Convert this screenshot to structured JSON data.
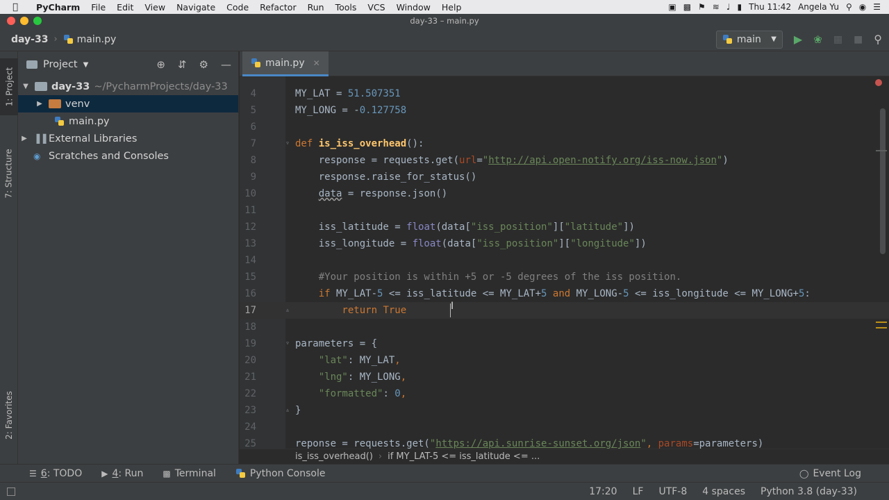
{
  "menubar": {
    "app_name": "PyCharm",
    "items": [
      "File",
      "Edit",
      "View",
      "Navigate",
      "Code",
      "Refactor",
      "Run",
      "Tools",
      "VCS",
      "Window",
      "Help"
    ],
    "clock": "Thu 11:42",
    "user": "Angela Yu"
  },
  "window": {
    "title": "day-33 – main.py"
  },
  "navbar": {
    "project": "day-33",
    "file": "main.py",
    "run_config": "main"
  },
  "left_stripe": {
    "project_tab": "1: Project",
    "structure_tab": "7: Structure",
    "favorites_tab": "2: Favorites"
  },
  "project_panel": {
    "title": "Project",
    "root_name": "day-33",
    "root_path": "~/PycharmProjects/day-33",
    "venv": "venv",
    "main_file": "main.py",
    "external_libraries": "External Libraries",
    "scratches": "Scratches and Consoles"
  },
  "editor": {
    "tab_label": "main.py",
    "current_line": 17,
    "line_numbers": [
      "4",
      "5",
      "6",
      "7",
      "8",
      "9",
      "10",
      "11",
      "12",
      "13",
      "14",
      "15",
      "16",
      "17",
      "18",
      "19",
      "20",
      "21",
      "22",
      "23",
      "24",
      "25"
    ],
    "code": {
      "l4_a": "MY_LAT = ",
      "l4_num": "51.507351",
      "l5_a": "MY_LONG = -",
      "l5_num": "0.127758",
      "l7_def": "def ",
      "l7_fn": "is_iss_overhead",
      "l7_rest": "():",
      "l8_a": "    response = requests.get(",
      "l8_param": "url",
      "l8_eq": "=",
      "l8_q1": "\"",
      "l8_url": "http://api.open-notify.org/iss-now.json",
      "l8_q2": "\"",
      "l8_end": ")",
      "l9": "    response.raise_for_status()",
      "l10_indent": "    ",
      "l10_data": "data",
      "l10_rest": " = response.json()",
      "l12_a": "    iss_latitude = ",
      "l12_fn": "float",
      "l12_b": "(data[",
      "l12_s1": "\"iss_position\"",
      "l12_c": "][",
      "l12_s2": "\"latitude\"",
      "l12_d": "])",
      "l13_a": "    iss_longitude = ",
      "l13_fn": "float",
      "l13_b": "(data[",
      "l13_s1": "\"iss_position\"",
      "l13_c": "][",
      "l13_s2": "\"longitude\"",
      "l13_d": "])",
      "l15": "    #Your position is within +5 or -5 degrees of the iss position.",
      "l16_if": "    if ",
      "l16_a": "MY_LAT-",
      "l16_n1": "5",
      "l16_b": " <= iss_latitude <= MY_LAT+",
      "l16_n2": "5",
      "l16_and": " and ",
      "l16_c": "MY_LONG-",
      "l16_n3": "5",
      "l16_d": " <= iss_longitude <= MY_LONG+",
      "l16_n4": "5",
      "l16_e": ":",
      "l17_ret": "        return ",
      "l17_true": "True",
      "l19": "parameters = {",
      "l20_s": "    \"lat\"",
      "l20_rest": ": MY_LAT",
      "l20_comma": ",",
      "l21_s": "    \"lng\"",
      "l21_rest": ": MY_LONG",
      "l21_comma": ",",
      "l22_s": "    \"formatted\"",
      "l22_rest": ": ",
      "l22_num": "0",
      "l22_comma": ",",
      "l23": "}",
      "l25_a": "reponse = requests.get(",
      "l25_q1": "\"",
      "l25_url": "https://api.sunrise-sunset.org/json",
      "l25_q2": "\"",
      "l25_comma": ", ",
      "l25_param": "params",
      "l25_rest": "=parameters)"
    }
  },
  "breadcrumbs": {
    "function": "is_iss_overhead()",
    "statement": "if MY_LAT-5 <= iss_latitude <= ..."
  },
  "tool_windows": {
    "todo_num": "6",
    "todo_label": ": TODO",
    "run_num": "4",
    "run_label": ": Run",
    "terminal": "Terminal",
    "python_console": "Python Console",
    "event_log": "Event Log"
  },
  "statusbar": {
    "position": "17:20",
    "line_sep": "LF",
    "encoding": "UTF-8",
    "indent": "4 spaces",
    "interpreter": "Python 3.8 (day-33)"
  },
  "colors": {
    "editor_bg": "#2b2b2b",
    "keyword": "#cc7832",
    "string": "#6a8759",
    "number": "#6897bb",
    "function": "#ffc66d"
  }
}
